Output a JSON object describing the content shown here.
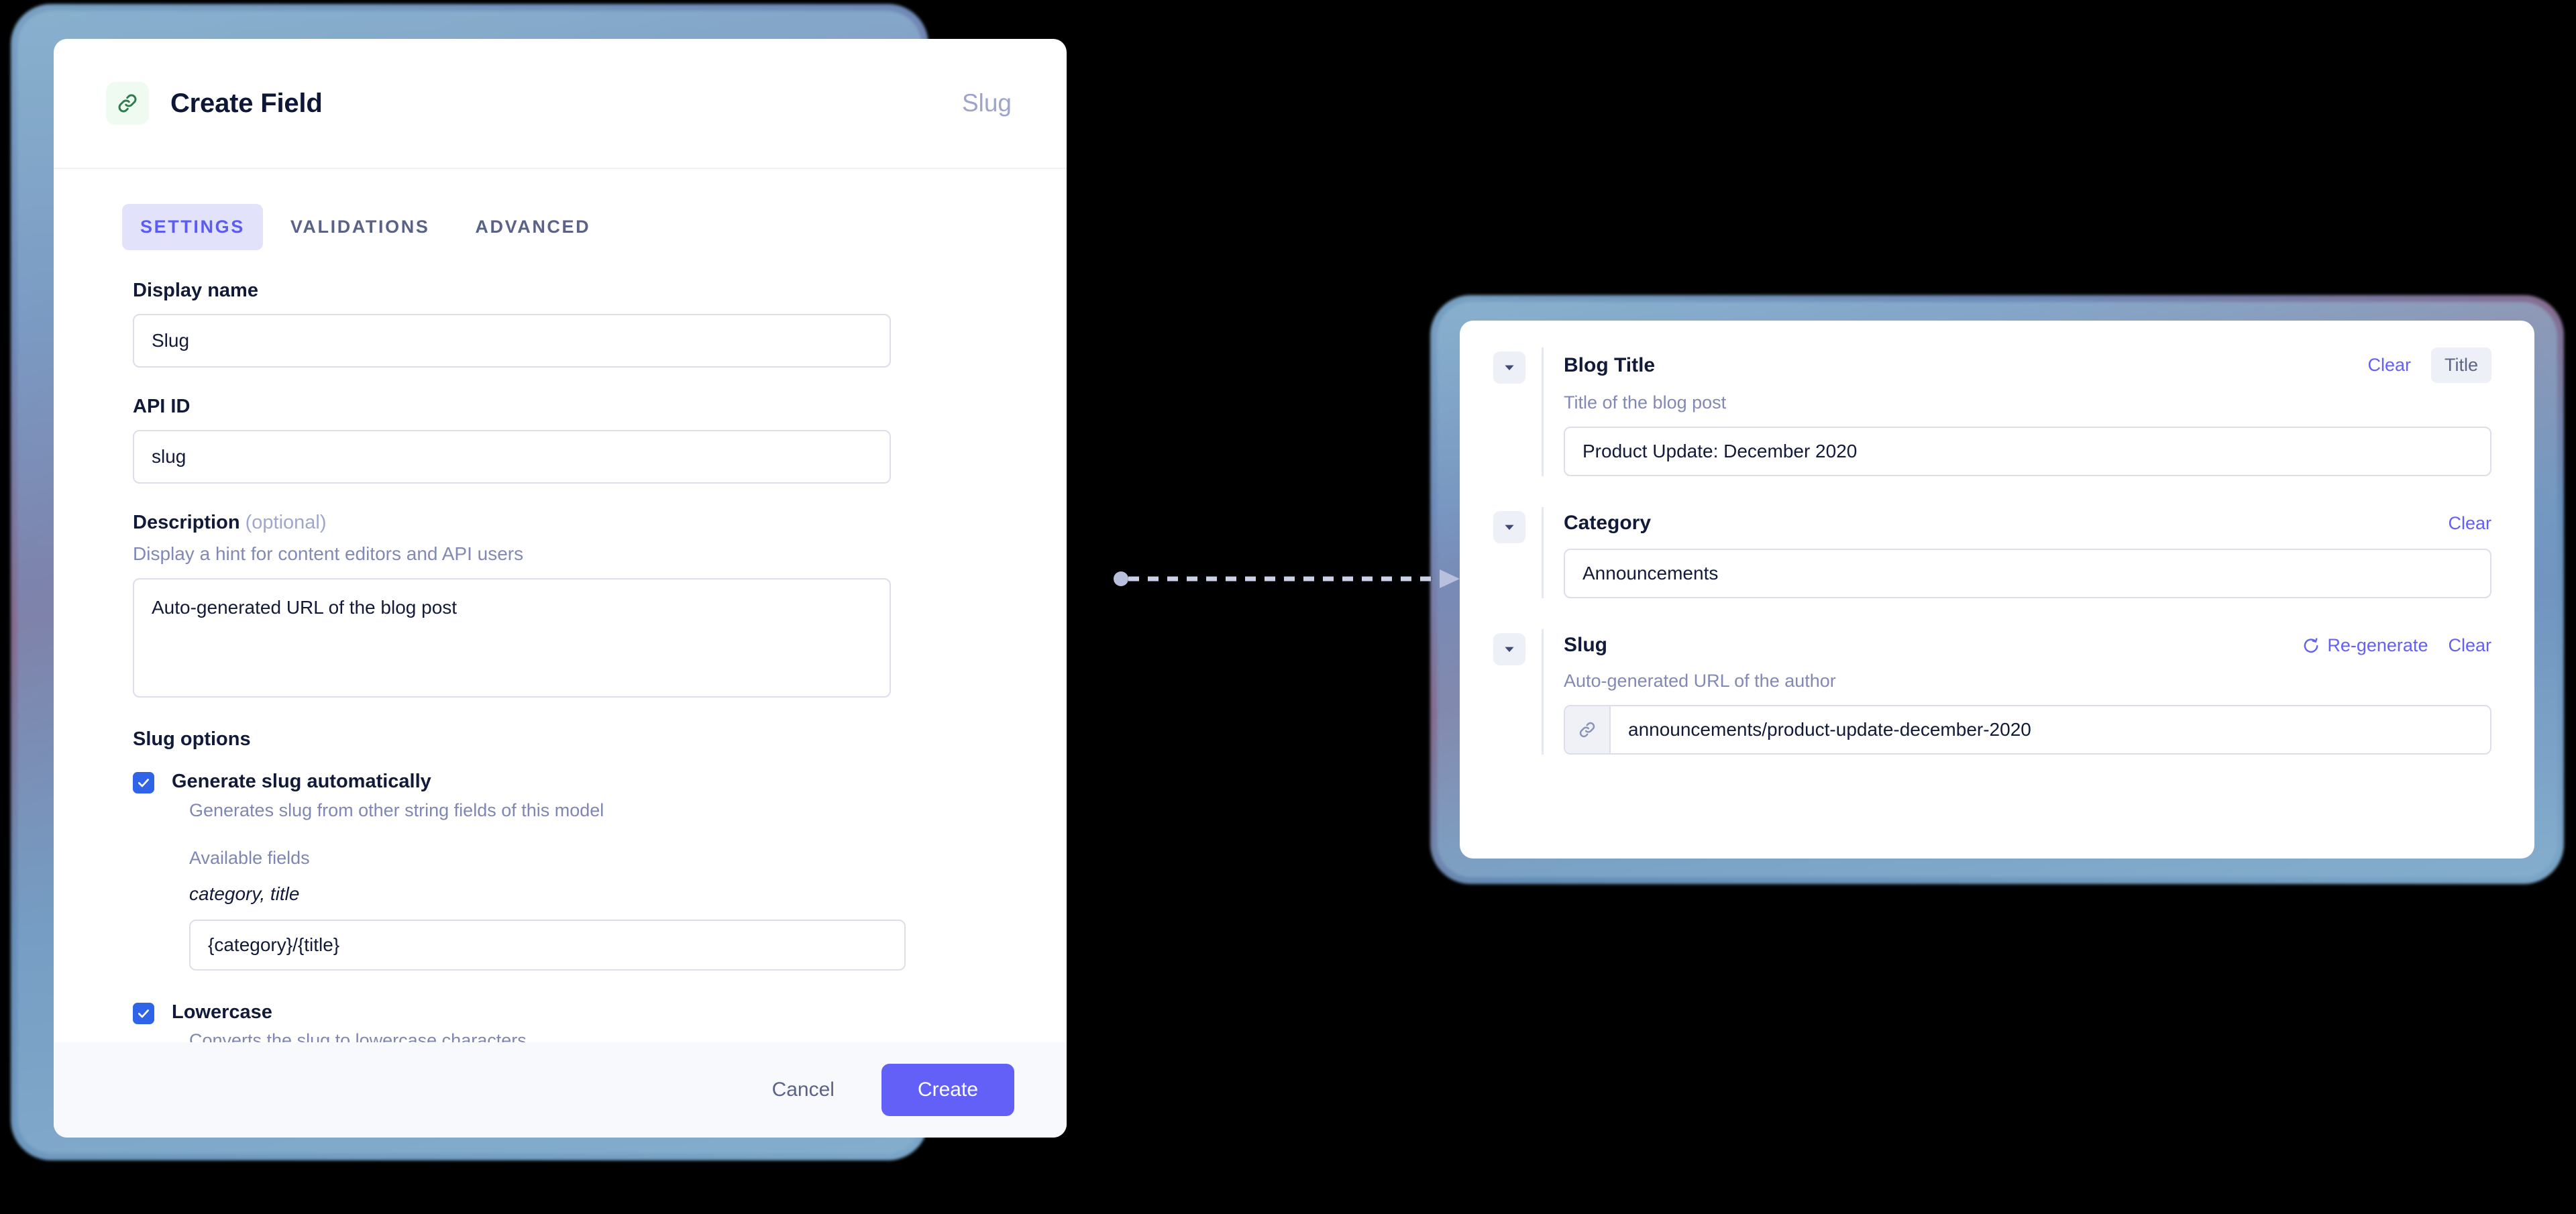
{
  "theme": {
    "accent_purple": "#6360f8",
    "tab_active_bg": "#e3e2fb",
    "tab_active_fg": "#5b5bf5",
    "checkbox_blue": "#2f63e8",
    "type_badge_green": "#2e7d4f",
    "muted_text": "#8189b4"
  },
  "create_field_dialog": {
    "icon": "link-icon",
    "title": "Create Field",
    "field_kind": "Slug",
    "tabs": [
      {
        "label": "SETTINGS",
        "active": true
      },
      {
        "label": "VALIDATIONS",
        "active": false
      },
      {
        "label": "ADVANCED",
        "active": false
      }
    ],
    "display_name": {
      "label": "Display name",
      "value": "Slug",
      "placeholder": "Display name"
    },
    "api_id": {
      "label": "API ID",
      "value": "slug",
      "placeholder": "API ID"
    },
    "description": {
      "label": "Description",
      "optional_suffix": "(optional)",
      "help": "Display a hint for content editors and API users",
      "value": "Auto-generated URL of the blog post",
      "placeholder": "Description"
    },
    "slug_options": {
      "section_label": "Slug options",
      "generate_auto": {
        "label": "Generate slug automatically",
        "sub": "Generates slug from other string fields of this model",
        "checked": true
      },
      "available_fields": {
        "title": "Available fields",
        "fields": "category, title",
        "template_value": "{category}/{title}",
        "template_placeholder": "{category}/{title}"
      },
      "lowercase": {
        "label": "Lowercase",
        "sub": "Converts the slug to lowercase characters",
        "checked": true
      }
    },
    "footer": {
      "cancel_label": "Cancel",
      "create_label": "Create"
    }
  },
  "entry_preview": {
    "sections": [
      {
        "name": "Blog Title",
        "help": "Title of the blog post",
        "clear_label": "Clear",
        "badge": "Title",
        "regenerate_label": null,
        "value": "Product Update: December 2020",
        "prefix_icon": null
      },
      {
        "name": "Category",
        "help": null,
        "clear_label": "Clear",
        "badge": null,
        "regenerate_label": null,
        "value": "Announcements",
        "prefix_icon": null
      },
      {
        "name": "Slug",
        "help": "Auto-generated URL of the author",
        "clear_label": "Clear",
        "badge": null,
        "regenerate_label": "Re-generate",
        "value": "announcements/product-update-december-2020",
        "prefix_icon": "link-icon"
      }
    ]
  }
}
